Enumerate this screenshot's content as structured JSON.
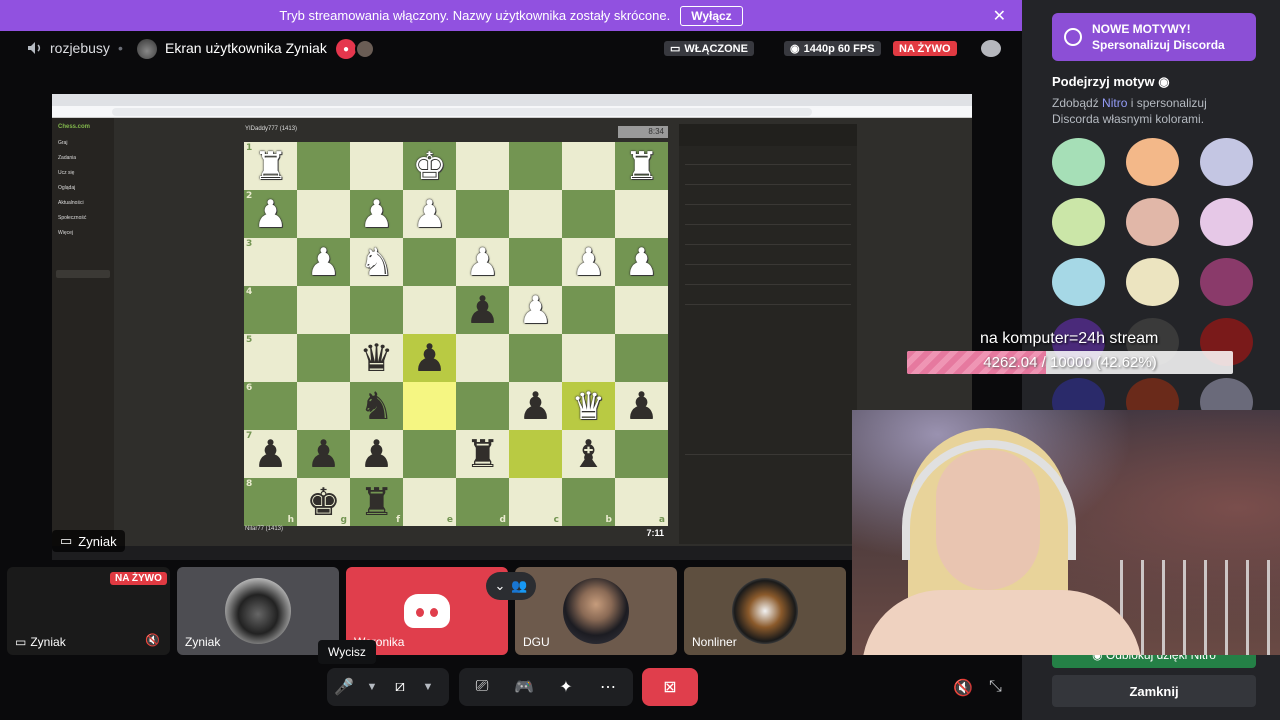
{
  "banner": {
    "text": "Tryb streamowania włączony. Nazwy użytkownika zostały skrócone.",
    "button": "Wyłącz"
  },
  "topbar": {
    "channel": "rozjebusy",
    "screen_title": "Ekran użytkownika Zyniak",
    "status_on": "WŁĄCZONE",
    "quality": "1440p 60 FPS",
    "live": "NA ŻYWO"
  },
  "chess": {
    "logo": "Chess.com",
    "nav": [
      "Graj",
      "Zadania",
      "Ucz się",
      "Oglądaj",
      "Aktualności",
      "Społeczność",
      "Więcej"
    ],
    "top_player": "YIDaddy777 (1413)",
    "top_clock": "8:34",
    "bottom_player": "Nilar77 (1413)",
    "bottom_clock": "7:11",
    "rank_labels": [
      "1",
      "2",
      "3",
      "4",
      "5",
      "6",
      "7",
      "8"
    ],
    "file_labels": [
      "h",
      "g",
      "f",
      "e",
      "d",
      "c",
      "b",
      "a"
    ],
    "board": [
      [
        "wR",
        "",
        "",
        "wK",
        "",
        "",
        "",
        "wR"
      ],
      [
        "wP",
        "",
        "wP",
        "wP",
        "",
        "",
        "",
        ""
      ],
      [
        "",
        "wP",
        "wN",
        "",
        "wP",
        "",
        "wP",
        "wP"
      ],
      [
        "",
        "",
        "",
        "",
        "bP",
        "wP",
        "",
        ""
      ],
      [
        "",
        "",
        "bQ",
        "bP",
        "",
        "",
        "",
        ""
      ],
      [
        "",
        "",
        "bN",
        "",
        "",
        "bP",
        "wQ",
        "bP"
      ],
      [
        "bP",
        "bP",
        "bP",
        "",
        "bR",
        "",
        "bB",
        ""
      ],
      [
        "",
        "bK",
        "bR",
        "",
        "",
        "",
        "",
        ""
      ]
    ],
    "highlight_light": [
      [
        5,
        3
      ]
    ],
    "highlight_dark": [
      [
        6,
        5
      ],
      [
        5,
        6
      ],
      [
        4,
        3
      ]
    ]
  },
  "presenter_label": "Zyniak",
  "tiles": [
    {
      "name": "Zyniak",
      "live": "NA ŻYWO"
    },
    {
      "name": "Zyniak"
    },
    {
      "name": "Weronika"
    },
    {
      "name": "DGU"
    },
    {
      "name": "Nonliner"
    }
  ],
  "controls": {
    "tooltip": "Wycisz"
  },
  "panel": {
    "promo_line1": "NOWE MOTYWY!",
    "promo_line2": "Spersonalizuj Discorda",
    "heading": "Podejrzyj motyw",
    "desc_before": "Zdobądź ",
    "desc_nitro": "Nitro",
    "desc_after": " i spersonalizuj Discorda własnymi kolorami.",
    "unlock": "Odblokuj dzięki Nitro",
    "close": "Zamknij",
    "swatches": [
      [
        "#a6dfb7",
        "#f3b889",
        "#c4c6e3"
      ],
      [
        "#cbe6a8",
        "#e1b7a8",
        "#e6c8e7"
      ],
      [
        "#a6d8e6",
        "#ece4c0",
        "#8a3a6a"
      ],
      [
        "#4a2a7a",
        "#3a3a3a",
        "#7a1a1a"
      ],
      [
        "#2a2a6a",
        "#6a2a1a",
        "#6a6a7a"
      ]
    ]
  },
  "stream_goal": {
    "title": "na komputer=24h stream",
    "progress_text": "4262.04 / 10000 (42.62%)",
    "percent": 42.62
  }
}
